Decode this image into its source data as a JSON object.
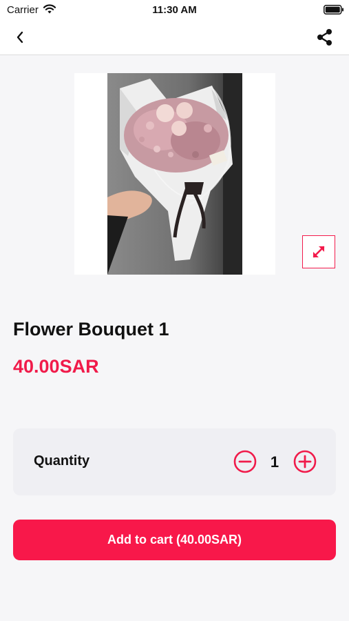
{
  "status_bar": {
    "carrier": "Carrier",
    "time": "11:30 AM"
  },
  "icons": {
    "back": "chevron-left-icon",
    "share": "share-icon",
    "expand": "expand-arrows-icon",
    "decrement": "minus-circle-icon",
    "increment": "plus-circle-icon"
  },
  "product": {
    "image_alt": "Flower bouquet in white wrapping",
    "title": "Flower Bouquet 1",
    "price": "40.00SAR"
  },
  "quantity": {
    "label": "Quantity",
    "value": "1"
  },
  "cart": {
    "button_label": "Add to cart (40.00SAR)"
  },
  "colors": {
    "accent": "#f8184a",
    "price": "#f01b4a",
    "background": "#f6f6f8",
    "card": "#efeff3"
  }
}
